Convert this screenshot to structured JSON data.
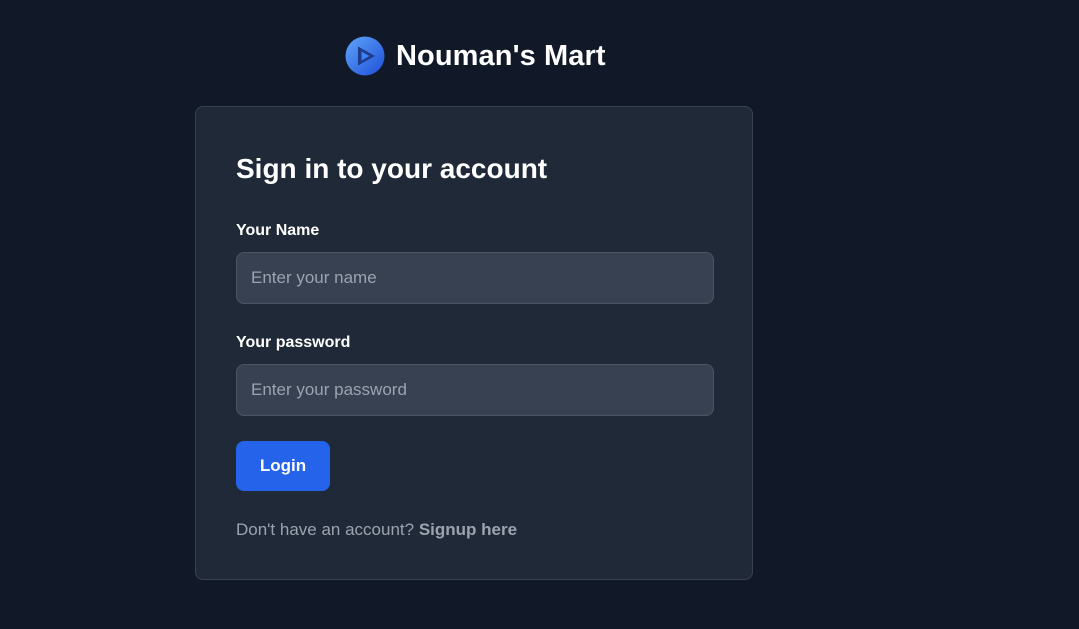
{
  "brand": {
    "name": "Nouman's Mart",
    "logo_icon": "play-circle-logo-icon",
    "logo_colors": [
      "#1d4ed8",
      "#3b82f6",
      "#60a5fa"
    ]
  },
  "form": {
    "title": "Sign in to your account",
    "name_label": "Your Name",
    "name_placeholder": "Enter your name",
    "name_value": "",
    "password_label": "Your password",
    "password_placeholder": "Enter your password",
    "password_value": "",
    "login_label": "Login",
    "signup_prompt": "Don't have an account?",
    "signup_link": "Signup here"
  },
  "colors": {
    "background": "#111827",
    "card": "#1f2937",
    "input": "#374151",
    "button": "#2563eb",
    "muted_text": "#9ca3af"
  }
}
